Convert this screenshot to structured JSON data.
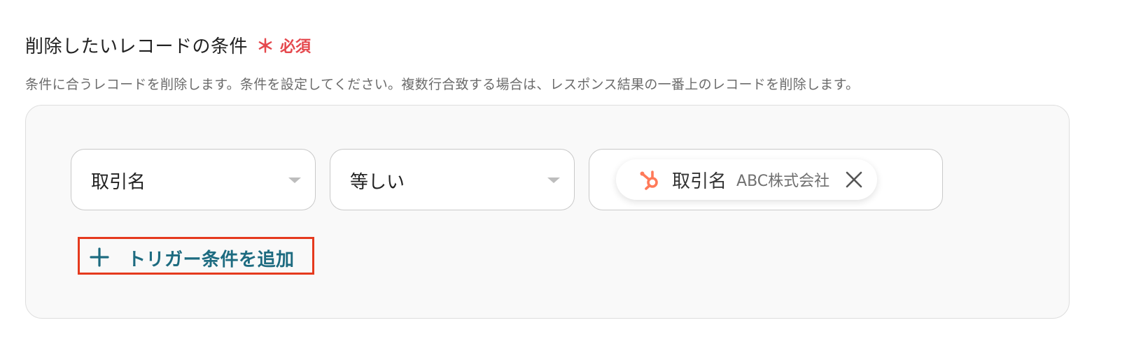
{
  "field": {
    "label": "削除したいレコードの条件",
    "asterisk": "＊",
    "required": "必須",
    "description": "条件に合うレコードを削除します。条件を設定してください。複数行合致する場合は、レスポンス結果の一番上のレコードを削除します。"
  },
  "condition": {
    "field_select": "取引名",
    "operator_select": "等しい",
    "value_chip": {
      "icon": "hubspot-icon",
      "field": "取引名",
      "value": "ABC株式会社"
    }
  },
  "add_condition_label": "トリガー条件を追加",
  "colors": {
    "required": "#e5484d",
    "accent": "#1d6b80",
    "highlight_border": "#e53a1e",
    "hubspot": "#ff7a59"
  }
}
